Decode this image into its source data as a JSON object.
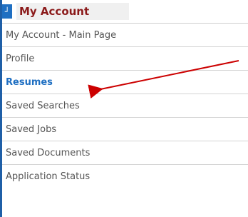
{
  "header": {
    "icon": "collapse-icon",
    "title": "My Account"
  },
  "menu": {
    "items": [
      {
        "label": "My Account - Main Page",
        "active": false
      },
      {
        "label": "Profile",
        "active": false
      },
      {
        "label": "Resumes",
        "active": true
      },
      {
        "label": "Saved Searches",
        "active": false
      },
      {
        "label": "Saved Jobs",
        "active": false
      },
      {
        "label": "Saved Documents",
        "active": false
      },
      {
        "label": "Application Status",
        "active": false
      }
    ]
  },
  "colors": {
    "accent": "#1f6fc2",
    "title": "#8b1a1a",
    "arrow": "#cc0000"
  },
  "annotation": {
    "icon": "arrow-pointer-icon"
  }
}
